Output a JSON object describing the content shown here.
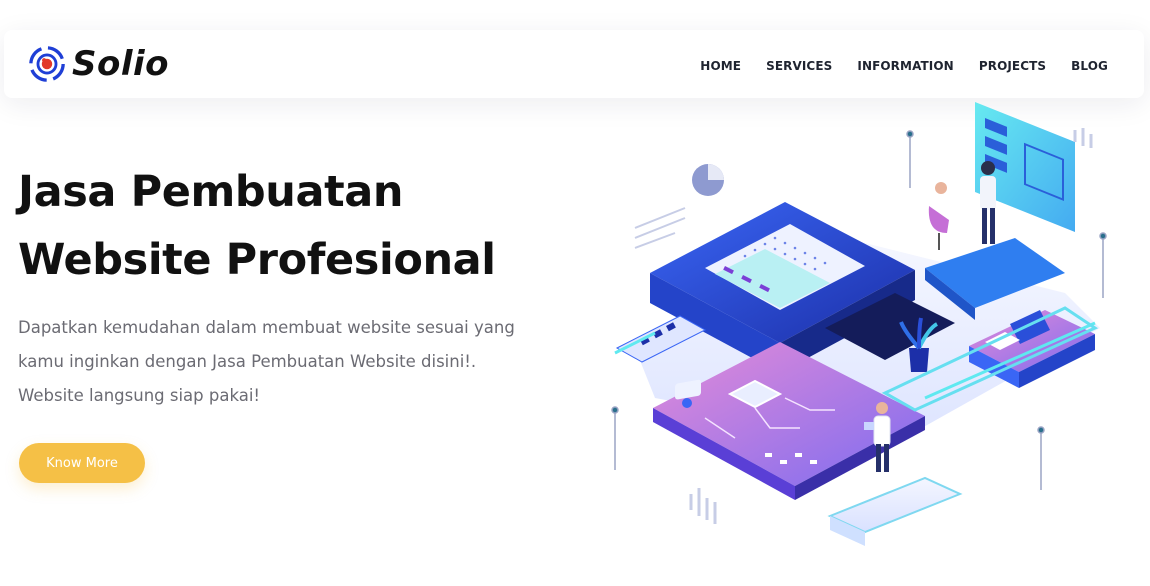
{
  "brand": {
    "name": "Solio",
    "logo_icon": "target-logo-icon",
    "colors": {
      "blue": "#1f3fd6",
      "red": "#e23a2a"
    }
  },
  "nav": {
    "items": [
      {
        "label": "HOME"
      },
      {
        "label": "SERVICES"
      },
      {
        "label": "INFORMATION"
      },
      {
        "label": "PROJECTS"
      },
      {
        "label": "BLOG"
      }
    ]
  },
  "hero": {
    "title_line1": "Jasa Pembuatan",
    "title_line2": "Website Profesional",
    "description": "Dapatkan kemudahan dalam membuat website sesuai yang kamu inginkan dengan Jasa Pembuatan Website disini!. Website langsung siap pakai!",
    "cta_label": "Know More",
    "cta_color": "#f5c046",
    "illustration": "isometric-server-dashboard-illustration"
  }
}
